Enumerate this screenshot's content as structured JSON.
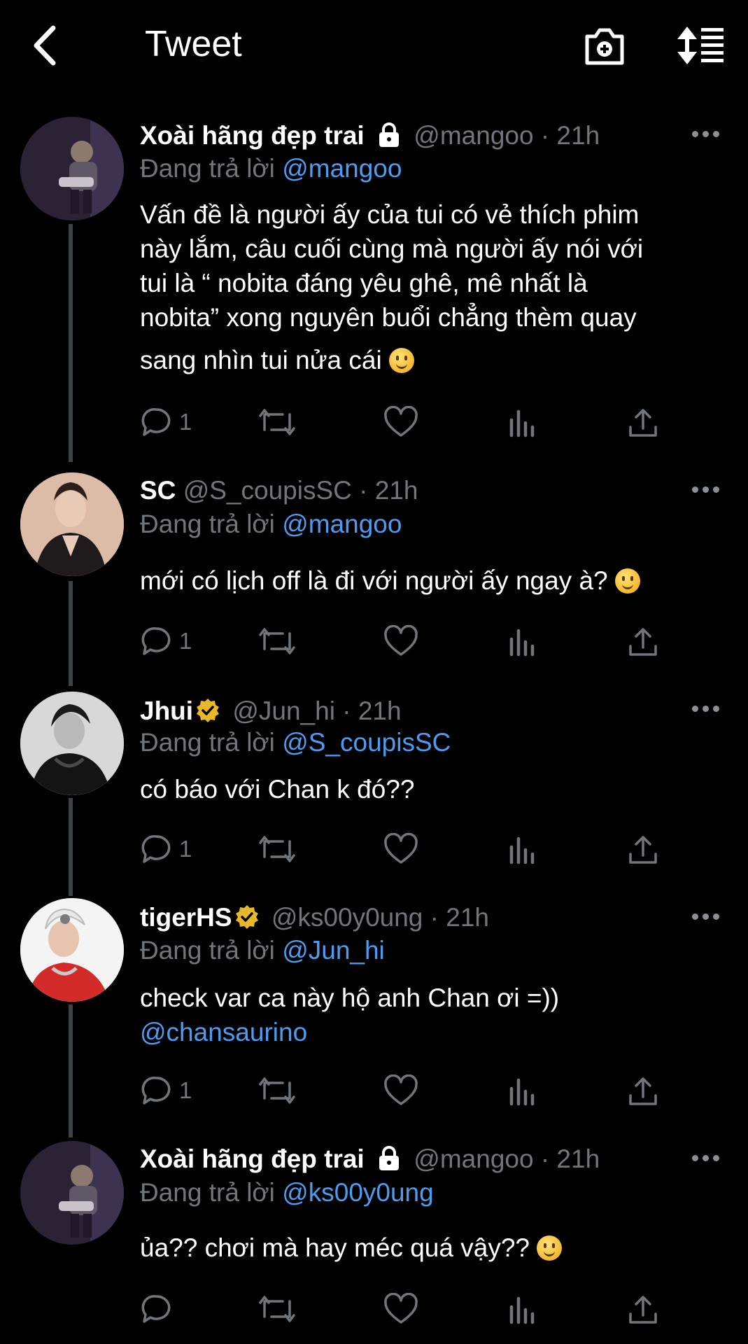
{
  "header": {
    "title": "Tweet"
  },
  "colors": {
    "background": "#000000",
    "text": "#ffffff",
    "muted": "#71767b",
    "mention": "#4e9cf0",
    "verified": "#e8b82a"
  },
  "tweets": [
    {
      "name": "Xoài hãng đẹp trai",
      "badge": "lock-icon",
      "handle": "@mangoo · 21h",
      "reply_prefix": "Đang trả lời",
      "reply_to": "@mangoo",
      "text_lines": [
        "Vấn đề là người ấy của tui có vẻ thích phim",
        "này lắm, câu cuối cùng mà người ấy nói với",
        "tui là “ nobita đáng yêu ghê, mê nhất là",
        "nobita” xong nguyên buổi chẳng thèm quay",
        "sang nhìn tui nửa cái"
      ],
      "reply_count": "1"
    },
    {
      "name": "SC",
      "badge": "",
      "handle": "@S_coupisSC · 21h",
      "reply_prefix": "Đang trả lời",
      "reply_to": "@mangoo",
      "text_lines": [
        "mới có lịch off là đi với người ấy ngay à?"
      ],
      "reply_count": "1"
    },
    {
      "name": "Jhui",
      "badge": "verified-badge-icon",
      "handle": "@Jun_hi · 21h",
      "reply_prefix": "Đang trả lời",
      "reply_to": "@S_coupisSC",
      "text_lines": [
        "có báo với Chan k đó??"
      ],
      "reply_count": "1"
    },
    {
      "name": "tigerHS",
      "badge": "verified-badge-icon",
      "handle": "@ks00y0ung · 21h",
      "reply_prefix": "Đang trả lời",
      "reply_to": "@Jun_hi",
      "text_lines": [
        "check var ca này hộ anh Chan ơi =))"
      ],
      "text_mention": "@chansaurino",
      "reply_count": "1"
    },
    {
      "name": "Xoài hãng đẹp trai",
      "badge": "lock-icon",
      "handle": "@mangoo · 21h",
      "reply_prefix": "Đang trả lời",
      "reply_to": "@ks00y0ung",
      "text_lines": [
        "ủa?? chơi mà hay méc quá vậy??"
      ],
      "reply_count": ""
    }
  ]
}
